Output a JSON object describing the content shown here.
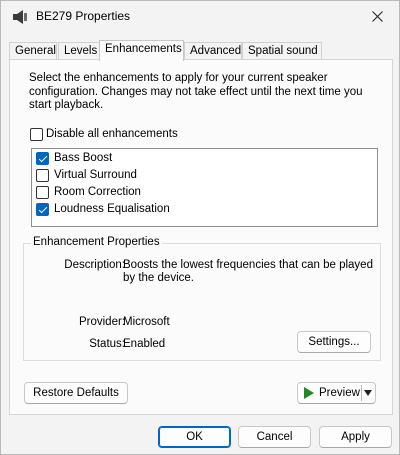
{
  "window": {
    "title": "BE279 Properties",
    "icon": "speaker-icon",
    "accent_color": "#0067c0"
  },
  "tabs": [
    {
      "label": "General",
      "active": false
    },
    {
      "label": "Levels",
      "active": false
    },
    {
      "label": "Enhancements",
      "active": true
    },
    {
      "label": "Advanced",
      "active": false
    },
    {
      "label": "Spatial sound",
      "active": false
    }
  ],
  "enhancements": {
    "intro": "Select the enhancements to apply for your current speaker configuration. Changes may not take effect until the next time you start playback.",
    "disable_all": {
      "label": "Disable all enhancements",
      "checked": false
    },
    "items": [
      {
        "label": "Bass Boost",
        "checked": true
      },
      {
        "label": "Virtual Surround",
        "checked": false
      },
      {
        "label": "Room Correction",
        "checked": false
      },
      {
        "label": "Loudness Equalisation",
        "checked": true
      }
    ]
  },
  "properties": {
    "title": "Enhancement Properties",
    "description_label": "Description:",
    "description_value_line1": "Boosts the lowest frequencies that can be played",
    "description_value_line2": "by the device.",
    "provider_label": "Provider:",
    "provider_value": "Microsoft",
    "status_label": "Status:",
    "status_value": "Enabled",
    "settings_button": "Settings..."
  },
  "buttons": {
    "restore_defaults": "Restore Defaults",
    "preview": "Preview",
    "ok": "OK",
    "cancel": "Cancel",
    "apply": "Apply"
  }
}
